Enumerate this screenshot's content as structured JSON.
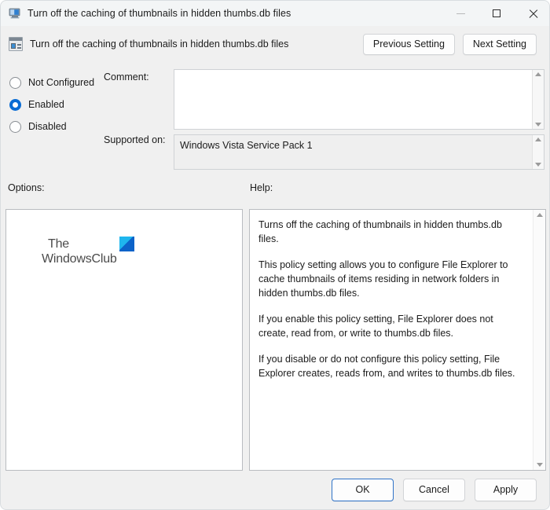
{
  "window": {
    "title": "Turn off the caching of thumbnails in hidden thumbs.db files",
    "icon": "policy-monitor-icon",
    "controls": {
      "minimize": "minimize-icon",
      "maximize": "maximize-icon",
      "close": "close-icon"
    }
  },
  "header": {
    "policy_title": "Turn off the caching of thumbnails in hidden thumbs.db files",
    "icon": "policy-setting-icon",
    "previous_setting": "Previous Setting",
    "next_setting": "Next Setting"
  },
  "state": {
    "options": [
      {
        "id": "not-configured",
        "label": "Not Configured",
        "selected": false
      },
      {
        "id": "enabled",
        "label": "Enabled",
        "selected": true
      },
      {
        "id": "disabled",
        "label": "Disabled",
        "selected": false
      }
    ],
    "selected_value": "Enabled"
  },
  "fields": {
    "comment_label": "Comment:",
    "comment_value": "",
    "comment_placeholder": "",
    "supported_label": "Supported on:",
    "supported_value": "Windows Vista Service Pack 1"
  },
  "sections": {
    "options_label": "Options:",
    "help_label": "Help:"
  },
  "help": {
    "paragraphs": [
      "Turns off the caching of thumbnails in hidden thumbs.db files.",
      "This policy setting allows you to configure File Explorer to cache thumbnails of items residing in network folders in hidden thumbs.db files.",
      "If you enable this policy setting, File Explorer does not create, read from, or write to thumbs.db files.",
      "If you disable or do not configure this policy setting, File Explorer creates, reads from, and writes to thumbs.db files."
    ]
  },
  "watermark": {
    "line1": "The",
    "line2": "WindowsClub",
    "icon": "windowsclub-logo-icon"
  },
  "footer": {
    "ok": "OK",
    "cancel": "Cancel",
    "apply": "Apply"
  },
  "colors": {
    "accent": "#0a6cd4",
    "focus_border": "#2f73c8",
    "dialog_bg": "#f0f0f0",
    "titlebar_bg": "#f3f5f6"
  }
}
